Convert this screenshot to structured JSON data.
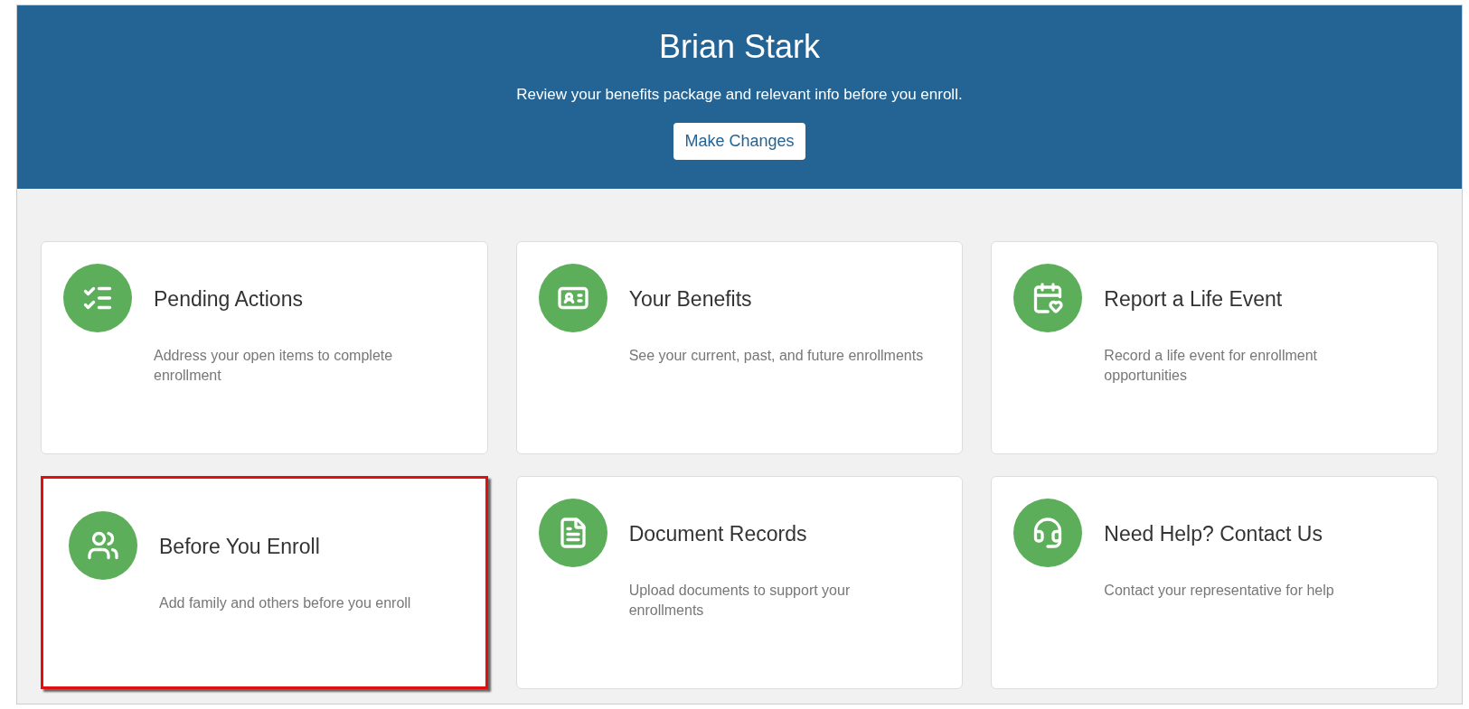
{
  "header": {
    "title": "Brian Stark",
    "subtitle": "Review your benefits package and relevant info before you enroll.",
    "button": "Make Changes"
  },
  "cards": [
    {
      "kind": "checklist",
      "title": "Pending Actions",
      "description": "Address your open items to complete enrollment",
      "highlighted": false
    },
    {
      "kind": "badge",
      "title": "Your Benefits",
      "description": "See your current, past, and future enrollments",
      "highlighted": false
    },
    {
      "kind": "calendar",
      "title": "Report a Life Event",
      "description": "Record a life event for enrollment opportunities",
      "highlighted": false
    },
    {
      "kind": "people",
      "title": "Before You Enroll",
      "description": "Add family and others before you enroll",
      "highlighted": true
    },
    {
      "kind": "document",
      "title": "Document Records",
      "description": "Upload documents to support your enrollments",
      "highlighted": false
    },
    {
      "kind": "headset",
      "title": "Need Help? Contact Us",
      "description": "Contact your representative for help",
      "highlighted": false
    }
  ]
}
